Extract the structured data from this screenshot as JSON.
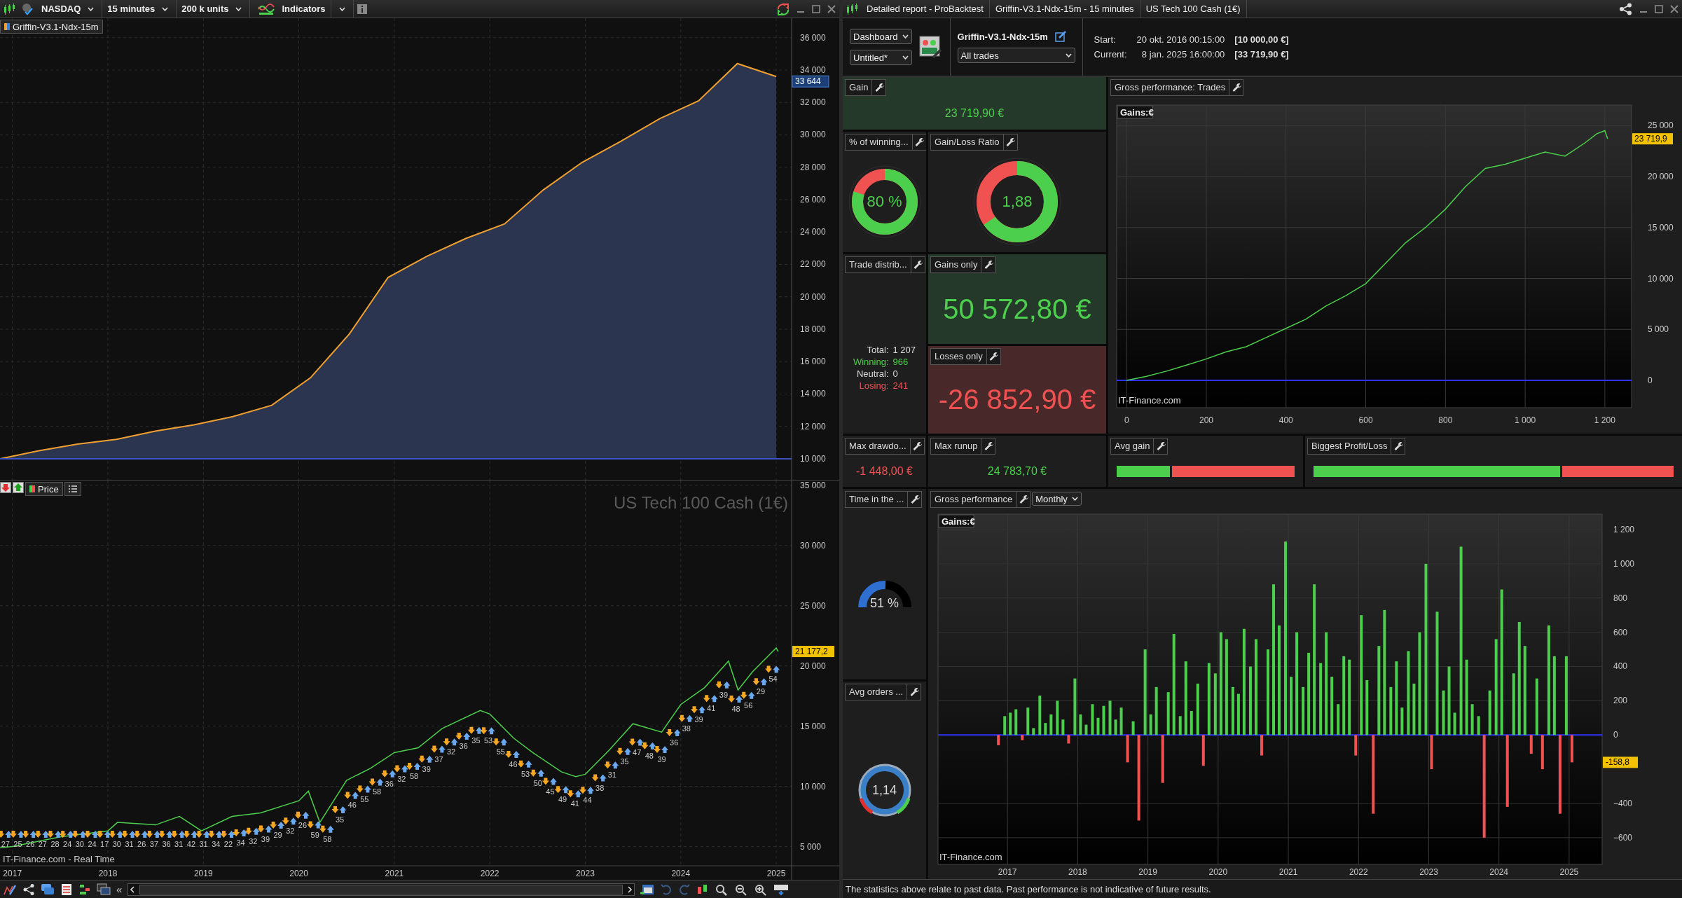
{
  "left_panel": {
    "toolbar": {
      "instrument": "NASDAQ",
      "timeframe": "15 minutes",
      "quantity": "200 k units",
      "indicators": "Indicators"
    },
    "equity_chart": {
      "last_value": "33 644",
      "chart_data": {
        "type": "area",
        "ylim": [
          8700,
          37200
        ],
        "grid": true,
        "ref_lines": [
          {
            "axis": "y",
            "value": 10000,
            "color": "#3b55c8"
          }
        ],
        "series": [
          {
            "name": "Griffin-V3.1-Ndx-15m",
            "color": "#f0a030",
            "values": [
              10000,
              10500,
              10900,
              11200,
              11700,
              12100,
              12600,
              13300,
              15000,
              17700,
              21200,
              22500,
              23600,
              24500,
              26600,
              28300,
              29600,
              31000,
              32100,
              34400,
              33600
            ]
          }
        ],
        "yticks": [
          {
            "value": 10000,
            "label": "10 000"
          },
          {
            "value": 12000,
            "label": "12 000"
          },
          {
            "value": 14000,
            "label": "14 000"
          },
          {
            "value": 16000,
            "label": "16 000"
          },
          {
            "value": 18000,
            "label": "18 000"
          },
          {
            "value": 20000,
            "label": "20 000"
          },
          {
            "value": 22000,
            "label": "22 000"
          },
          {
            "value": 24000,
            "label": "24 000"
          },
          {
            "value": 26000,
            "label": "26 000"
          },
          {
            "value": 28000,
            "label": "28 000"
          },
          {
            "value": 30000,
            "label": "30 000"
          },
          {
            "value": 32000,
            "label": "32 000"
          },
          {
            "value": 34000,
            "label": "34 000"
          },
          {
            "value": 36000,
            "label": "36 000"
          }
        ]
      }
    },
    "price_chart": {
      "title": "US Tech 100 Cash (1€)",
      "watermark": "IT-Finance.com - Real Time",
      "last_value": "21 177,2",
      "chart_data": {
        "type": "line",
        "xlim": [
          2016.87,
          2025.66
        ],
        "ylim": [
          3400,
          35400
        ],
        "grid": true,
        "x": [
          2016.87,
          2017,
          2017.5,
          2018,
          2018.1,
          2018.5,
          2018.75,
          2018.98,
          2019.3,
          2019.6,
          2020,
          2020.1,
          2020.22,
          2020.5,
          2020.75,
          2021,
          2021.25,
          2021.5,
          2021.9,
          2022,
          2022.25,
          2022.45,
          2022.75,
          2022.9,
          2023,
          2023.25,
          2023.5,
          2023.8,
          2024,
          2024.25,
          2024.5,
          2024.6,
          2024.75,
          2025,
          2025.02
        ],
        "series": [
          {
            "name": "Price",
            "color": "#4ccf4c",
            "values": [
              4900,
              5000,
              5800,
              6300,
              7000,
              6800,
              7500,
              6300,
              7500,
              7800,
              8800,
              9600,
              7000,
              10500,
              11500,
              12800,
              13200,
              14800,
              16300,
              16000,
              14000,
              12800,
              11200,
              10800,
              11000,
              13000,
              15200,
              14500,
              16800,
              18200,
              20400,
              18000,
              19500,
              21500,
              21200
            ]
          }
        ],
        "xticks": [
          {
            "value": 2017,
            "label": "2017"
          },
          {
            "value": 2018,
            "label": "2018"
          },
          {
            "value": 2019,
            "label": "2019"
          },
          {
            "value": 2020,
            "label": "2020"
          },
          {
            "value": 2021,
            "label": "2021"
          },
          {
            "value": 2022,
            "label": "2022"
          },
          {
            "value": 2023,
            "label": "2023"
          },
          {
            "value": 2024,
            "label": "2024"
          },
          {
            "value": 2025,
            "label": "2025"
          }
        ],
        "yticks": [
          {
            "value": 5000,
            "label": "5 000"
          },
          {
            "value": 10000,
            "label": "10 000"
          },
          {
            "value": 15000,
            "label": "15 000"
          },
          {
            "value": 20000,
            "label": "20 000"
          },
          {
            "value": 25000,
            "label": "25 000"
          },
          {
            "value": 30000,
            "label": "30 000"
          },
          {
            "value": 35000,
            "label": "35 000"
          }
        ]
      },
      "trade_labels": [
        "27",
        "25",
        "26",
        "27",
        "28",
        "24",
        "30",
        "24",
        "17",
        "30",
        "31",
        "26",
        "37",
        "36",
        "31",
        "42",
        "31",
        "34",
        "22",
        "34",
        "32",
        "39",
        "29",
        "32",
        "26",
        "59",
        "58",
        "35",
        "46",
        "55",
        "58",
        "36",
        "32",
        "58",
        "39",
        "37",
        "32",
        "36",
        "35",
        "53",
        "55",
        "46",
        "53",
        "50",
        "45",
        "49",
        "41",
        "44",
        "38",
        "31",
        "35",
        "47",
        "48",
        "39",
        "36",
        "38",
        "39",
        "41",
        "39",
        "48",
        "56",
        "29",
        "54"
      ]
    },
    "bottom_toolbar": {
      "collapse": "«"
    }
  },
  "right_panel": {
    "title_segments": [
      "Detailed report - ProBacktest",
      "Griffin-V3.1-Ndx-15m - 15 minutes",
      "US Tech 100 Cash (1€)"
    ],
    "header": {
      "view_select": "Dashboard",
      "layout_select": "Untitled*",
      "strategy": "Griffin-V3.1-Ndx-15m",
      "trades_select": "All trades",
      "periods": [
        {
          "label": "Start:",
          "date": "20 okt. 2016 00:15:00",
          "capital": "[10 000,00 €]"
        },
        {
          "label": "Current:",
          "date": "8 jan. 2025 16:00:00",
          "capital": "[33 719,90 €]"
        }
      ]
    },
    "widgets": {
      "gain": {
        "title": "Gain",
        "value": "23 719,90 €"
      },
      "winning_pct": {
        "title": "% of winning...",
        "value": "80 %",
        "level": 0.8
      },
      "gain_loss_ratio": {
        "title": "Gain/Loss Ratio",
        "value": "1,88",
        "level": 0.653
      },
      "trade_distribution": {
        "title": "Trade distrib...",
        "rows": [
          {
            "kind": "total",
            "label": "Total:",
            "value": "1 207"
          },
          {
            "kind": "winning",
            "label": "Winning:",
            "value": "966"
          },
          {
            "kind": "neutral",
            "label": "Neutral:",
            "value": "0"
          },
          {
            "kind": "losing",
            "label": "Losing:",
            "value": "241"
          }
        ]
      },
      "gains_only": {
        "title": "Gains only",
        "value": "50 572,80 €"
      },
      "losses_only": {
        "title": "Losses only",
        "value": "-26 852,90 €"
      },
      "max_drawdown": {
        "title": "Max drawdo...",
        "value": "-1 448,00 €"
      },
      "max_runup": {
        "title": "Max runup",
        "value": "24 783,70 €"
      },
      "avg_gain": {
        "title": "Avg gain",
        "level": 0.31
      },
      "biggest_profit_loss": {
        "title": "Biggest Profit/Loss",
        "level": 0.69
      },
      "time_in_market": {
        "title": "Time in the ...",
        "value": "51 %",
        "level": 0.51
      },
      "avg_orders": {
        "title": "Avg orders ...",
        "value": "1,14"
      },
      "trades_chart": {
        "title": "Gross performance: Trades",
        "legend": "Gains:€",
        "watermark": "IT-Finance.com",
        "last_value": "23 719,9",
        "chart_data": {
          "type": "line",
          "xlim": [
            -25,
            1267
          ],
          "ylim": [
            -2680,
            27010
          ],
          "grid": true,
          "ref_lines": [
            {
              "axis": "y",
              "value": 0,
              "color": "#3030ff"
            }
          ],
          "x": [
            0,
            50,
            100,
            150,
            200,
            250,
            300,
            350,
            400,
            450,
            500,
            550,
            600,
            650,
            700,
            750,
            800,
            850,
            900,
            950,
            1000,
            1050,
            1100,
            1150,
            1180,
            1200,
            1207
          ],
          "series": [
            {
              "color": "#4ccf4c",
              "values": [
                0,
                400,
                900,
                1500,
                2100,
                2800,
                3300,
                4200,
                5100,
                6000,
                7300,
                8300,
                9500,
                11500,
                13500,
                15000,
                16800,
                19000,
                20800,
                21200,
                21800,
                22400,
                22000,
                23300,
                24200,
                24500,
                23700
              ]
            }
          ],
          "xticks": [
            {
              "value": 0,
              "label": "0"
            },
            {
              "value": 200,
              "label": "200"
            },
            {
              "value": 400,
              "label": "400"
            },
            {
              "value": 600,
              "label": "600"
            },
            {
              "value": 800,
              "label": "800"
            },
            {
              "value": 1000,
              "label": "1 000"
            },
            {
              "value": 1200,
              "label": "1 200"
            }
          ],
          "yticks": [
            {
              "value": 0,
              "label": "0"
            },
            {
              "value": 5000,
              "label": "5 000"
            },
            {
              "value": 10000,
              "label": "10 000"
            },
            {
              "value": 15000,
              "label": "15 000"
            },
            {
              "value": 20000,
              "label": "20 000"
            },
            {
              "value": 25000,
              "label": "25 000"
            }
          ]
        }
      },
      "monthly_chart": {
        "title": "Gross performance",
        "period": "Monthly",
        "legend": "Gains:€",
        "watermark": "IT-Finance.com",
        "last_value": "-158,8",
        "chart_data": {
          "type": "bar",
          "xlim": [
            2016.01,
            2025.47
          ],
          "ylim": [
            -756,
            1290
          ],
          "grid": true,
          "ref_lines": [
            {
              "axis": "y",
              "value": 0,
              "color": "#3030ff"
            }
          ],
          "x": [
            2016.87,
            2016.96,
            2017.04,
            2017.12,
            2017.21,
            2017.29,
            2017.37,
            2017.46,
            2017.54,
            2017.62,
            2017.71,
            2017.79,
            2017.87,
            2017.96,
            2018.04,
            2018.12,
            2018.21,
            2018.29,
            2018.37,
            2018.46,
            2018.54,
            2018.62,
            2018.71,
            2018.79,
            2018.87,
            2018.96,
            2019.04,
            2019.12,
            2019.21,
            2019.29,
            2019.37,
            2019.46,
            2019.54,
            2019.62,
            2019.71,
            2019.79,
            2019.87,
            2019.96,
            2020.04,
            2020.12,
            2020.21,
            2020.29,
            2020.37,
            2020.46,
            2020.54,
            2020.62,
            2020.71,
            2020.79,
            2020.87,
            2020.96,
            2021.04,
            2021.12,
            2021.21,
            2021.29,
            2021.37,
            2021.46,
            2021.54,
            2021.62,
            2021.71,
            2021.79,
            2021.87,
            2021.96,
            2022.04,
            2022.12,
            2022.21,
            2022.29,
            2022.37,
            2022.46,
            2022.54,
            2022.62,
            2022.71,
            2022.79,
            2022.87,
            2022.96,
            2023.04,
            2023.12,
            2023.21,
            2023.29,
            2023.37,
            2023.46,
            2023.54,
            2023.62,
            2023.71,
            2023.79,
            2023.87,
            2023.96,
            2024.04,
            2024.12,
            2024.21,
            2024.29,
            2024.37,
            2024.46,
            2024.54,
            2024.62,
            2024.71,
            2024.79,
            2024.87,
            2024.96,
            2025.04
          ],
          "xticks": [
            {
              "value": 2017,
              "label": "2017"
            },
            {
              "value": 2018,
              "label": "2018"
            },
            {
              "value": 2019,
              "label": "2019"
            },
            {
              "value": 2020,
              "label": "2020"
            },
            {
              "value": 2021,
              "label": "2021"
            },
            {
              "value": 2022,
              "label": "2022"
            },
            {
              "value": 2023,
              "label": "2023"
            },
            {
              "value": 2024,
              "label": "2024"
            },
            {
              "value": 2025,
              "label": "2025"
            }
          ],
          "yticks": [
            {
              "value": -600,
              "label": "−600"
            },
            {
              "value": -400,
              "label": "−400"
            },
            {
              "value": 0,
              "label": "0"
            },
            {
              "value": 200,
              "label": "200"
            },
            {
              "value": 400,
              "label": "400"
            },
            {
              "value": 600,
              "label": "600"
            },
            {
              "value": 800,
              "label": "800"
            },
            {
              "value": 1000,
              "label": "1 000"
            },
            {
              "value": 1200,
              "label": "1 200"
            }
          ],
          "series": [
            {
              "values": [
                -60,
                110,
                130,
                150,
                -30,
                160,
                40,
                230,
                70,
                120,
                200,
                90,
                -50,
                330,
                120,
                60,
                180,
                100,
                170,
                200,
                90,
                160,
                -160,
                80,
                -500,
                500,
                120,
                280,
                -280,
                250,
                590,
                110,
                430,
                140,
                300,
                -180,
                420,
                360,
                600,
                560,
                280,
                240,
                620,
                400,
                560,
                -120,
                500,
                880,
                640,
                1130,
                340,
                600,
                280,
                480,
                880,
                420,
                600,
                340,
                180,
                460,
                440,
                -120,
                700,
                320,
                -460,
                520,
                730,
                280,
                430,
                160,
                490,
                300,
                600,
                1000,
                -200,
                720,
                260,
                400,
                130,
                1100,
                440,
                180,
                110,
                -600,
                260,
                560,
                850,
                -420,
                360,
                660,
                520,
                -110,
                330,
                -200,
                640,
                460,
                -460,
                460,
                -160
              ]
            }
          ]
        }
      }
    },
    "footer": "The statistics above relate to past data. Past performance is not indicative of future results."
  }
}
